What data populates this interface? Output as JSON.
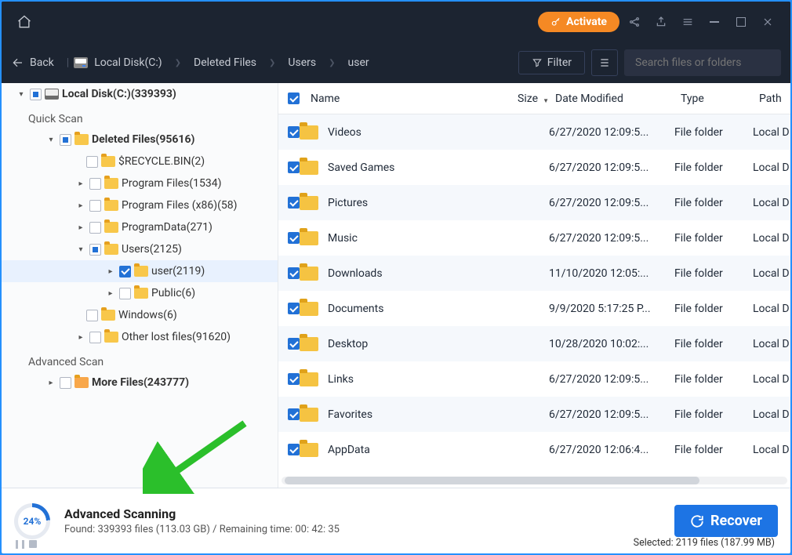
{
  "titlebar": {
    "activate": "Activate"
  },
  "nav": {
    "back": "Back",
    "crumbs": [
      "Local Disk(C:)",
      "Deleted Files",
      "Users",
      "user"
    ],
    "filter": "Filter",
    "search_placeholder": "Search files or folders"
  },
  "tree": {
    "root": "Local Disk(C:)(339393)",
    "quick_scan": "Quick Scan",
    "deleted_files": "Deleted Files(95616)",
    "items": [
      "$RECYCLE.BIN(2)",
      "Program Files(1534)",
      "Program Files (x86)(58)",
      "ProgramData(271)",
      "Users(2125)",
      "user(2119)",
      "Public(6)",
      "Windows(6)",
      "Other lost files(91620)"
    ],
    "adv_scan": "Advanced Scan",
    "more_files": "More Files(243777)"
  },
  "columns": {
    "name": "Name",
    "size": "Size",
    "date": "Date Modified",
    "type": "Type",
    "path": "Path"
  },
  "rows": [
    {
      "name": "Videos",
      "date": "6/27/2020 12:09:5...",
      "type": "File folder",
      "path": "Local D"
    },
    {
      "name": "Saved Games",
      "date": "6/27/2020 12:09:5...",
      "type": "File folder",
      "path": "Local D"
    },
    {
      "name": "Pictures",
      "date": "6/27/2020 12:09:5...",
      "type": "File folder",
      "path": "Local D"
    },
    {
      "name": "Music",
      "date": "6/27/2020 12:09:5...",
      "type": "File folder",
      "path": "Local D"
    },
    {
      "name": "Downloads",
      "date": "11/10/2020 12:05:...",
      "type": "File folder",
      "path": "Local D"
    },
    {
      "name": "Documents",
      "date": "9/9/2020 5:17:25 P...",
      "type": "File folder",
      "path": "Local D"
    },
    {
      "name": "Desktop",
      "date": "10/28/2020 10:02:...",
      "type": "File folder",
      "path": "Local D"
    },
    {
      "name": "Links",
      "date": "6/27/2020 12:09:5...",
      "type": "File folder",
      "path": "Local D"
    },
    {
      "name": "Favorites",
      "date": "6/27/2020 12:09:5...",
      "type": "File folder",
      "path": "Local D"
    },
    {
      "name": "AppData",
      "date": "6/27/2020 12:06:4...",
      "type": "File folder",
      "path": "Local D"
    }
  ],
  "footer": {
    "percent": "24%",
    "title": "Advanced Scanning",
    "sub": "Found: 339393 files (113.03 GB) / Remaining time: 00: 42: 35",
    "recover": "Recover",
    "selected": "Selected: 2119 files (187.99 MB)"
  }
}
